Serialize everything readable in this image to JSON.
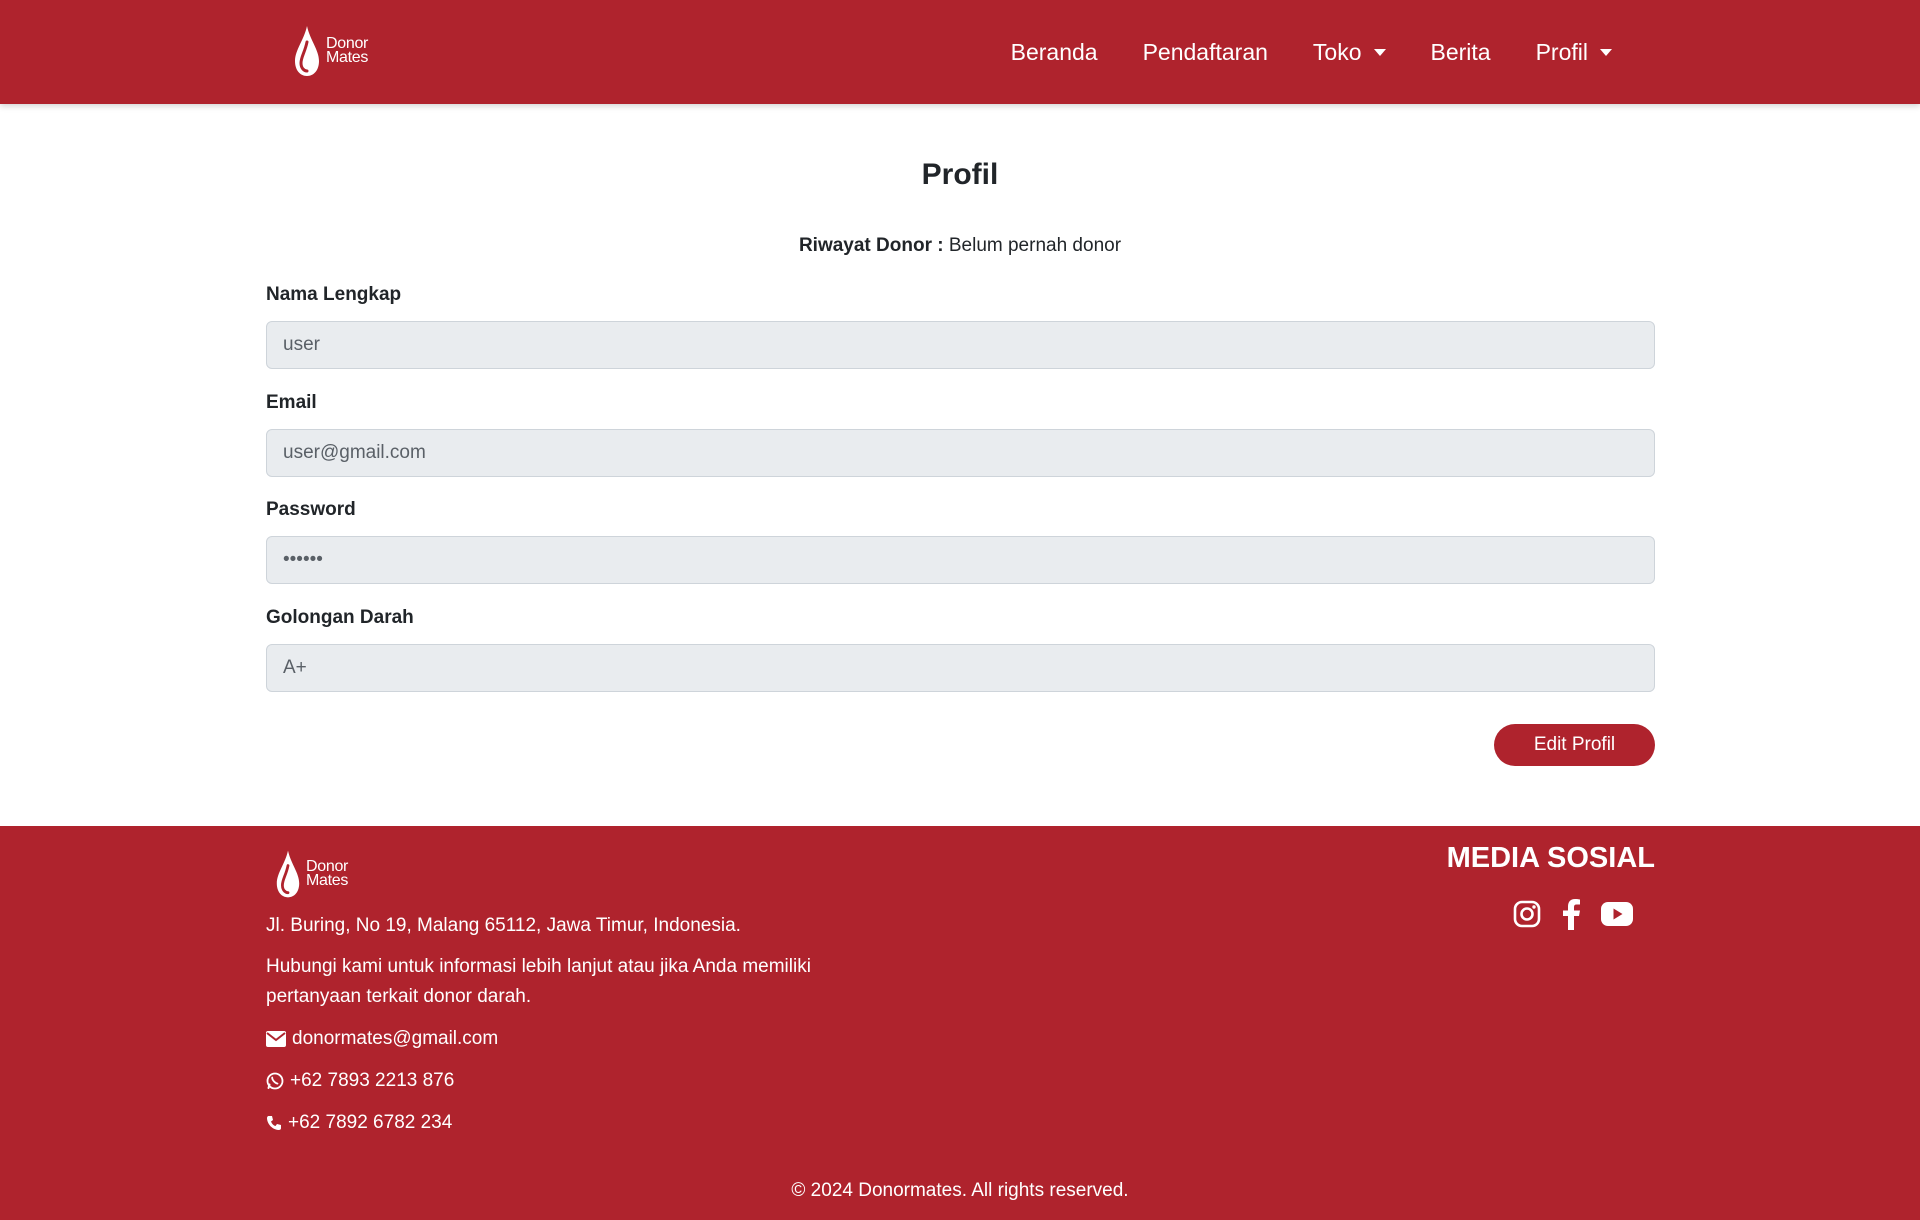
{
  "navbar": {
    "logo": {
      "line1": "Donor",
      "line2": "Mates"
    },
    "items": [
      {
        "label": "Beranda"
      },
      {
        "label": "Pendaftaran"
      },
      {
        "label": "Toko"
      },
      {
        "label": "Berita"
      },
      {
        "label": "Profil"
      }
    ]
  },
  "main": {
    "title": "Profil",
    "riwayat_label": "Riwayat Donor :",
    "riwayat_value": "Belum pernah donor",
    "fields": [
      {
        "label": "Nama Lengkap",
        "value": "user"
      },
      {
        "label": "Email",
        "value": "user@gmail.com"
      },
      {
        "label": "Password",
        "value": "••••••"
      },
      {
        "label": "Golongan Darah",
        "value": "A+"
      }
    ],
    "edit_button": "Edit Profil"
  },
  "footer": {
    "logo": {
      "line1": "Donor",
      "line2": "Mates"
    },
    "address": "Jl. Buring, No 19, Malang 65112, Jawa Timur, Indonesia.",
    "description_line1": "Hubungi kami untuk informasi lebih lanjut atau jika Anda memiliki",
    "description_line2": "pertanyaan terkait donor darah.",
    "email": "donormates@gmail.com",
    "whatsapp": "+62 7893 2213 876",
    "phone": "+62 7892 6782 234",
    "media_title": "MEDIA SOSIAL",
    "social_icons": [
      "instagram-icon",
      "facebook-icon",
      "youtube-icon"
    ],
    "copyright": "© 2024 Donormates. All rights reserved."
  },
  "colors": {
    "brand": "#af232d",
    "input_bg": "#e9ecef"
  }
}
